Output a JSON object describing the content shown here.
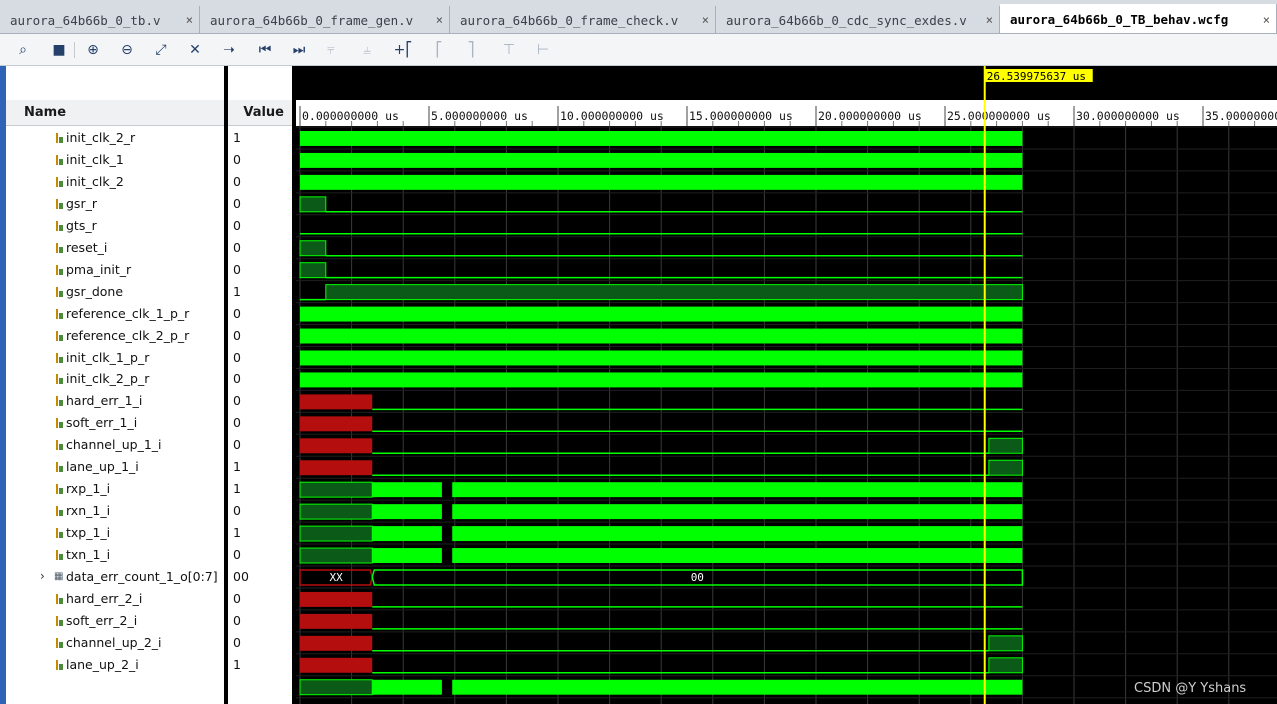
{
  "tabs": [
    {
      "label": "aurora_64b66b_0_tb.v",
      "close": "×",
      "active": false
    },
    {
      "label": "aurora_64b66b_0_frame_gen.v",
      "close": "×",
      "active": false
    },
    {
      "label": "aurora_64b66b_0_frame_check.v",
      "close": "×",
      "active": false
    },
    {
      "label": "aurora_64b66b_0_cdc_sync_exdes.v",
      "close": "×",
      "active": false
    },
    {
      "label": "aurora_64b66b_0_TB_behav.wcfg",
      "close": "×",
      "active": true
    }
  ],
  "toolbar": {
    "buttons": [
      "search-icon",
      "save-icon",
      "zoom-in-icon",
      "zoom-out-icon",
      "zoom-fit-icon",
      "cursor-remove-icon",
      "go-to-time-icon",
      "go-to-start-icon",
      "go-to-end-icon",
      "add-marker-icon",
      "remove-marker-icon",
      "add-marker-plus-icon",
      "previous-edge-icon",
      "next-edge-icon",
      "previous-transition-icon",
      "swap-cursor-icon"
    ]
  },
  "columns": {
    "name": "Name",
    "value": "Value"
  },
  "cursor": {
    "label": "26.539975637 us",
    "time_us": 26.539975637
  },
  "time_axis": {
    "ticks": [
      "0.000000000 us",
      "5.000000000 us",
      "10.000000000 us",
      "15.000000000 us",
      "20.000000000 us",
      "25.000000000 us",
      "30.000000000 us",
      "35.00000000"
    ],
    "sim_end_us": 28.0
  },
  "signals": [
    {
      "name": "init_clk_2_r",
      "value": "1",
      "wave": "clock"
    },
    {
      "name": "init_clk_1",
      "value": "0",
      "wave": "clock"
    },
    {
      "name": "init_clk_2",
      "value": "0",
      "wave": "clock"
    },
    {
      "name": "gsr_r",
      "value": "0",
      "wave": "pulse_start"
    },
    {
      "name": "gts_r",
      "value": "0",
      "wave": "low"
    },
    {
      "name": "reset_i",
      "value": "0",
      "wave": "pulse_start"
    },
    {
      "name": "pma_init_r",
      "value": "0",
      "wave": "pulse_start"
    },
    {
      "name": "gsr_done",
      "value": "1",
      "wave": "rise_early"
    },
    {
      "name": "reference_clk_1_p_r",
      "value": "0",
      "wave": "clock"
    },
    {
      "name": "reference_clk_2_p_r",
      "value": "0",
      "wave": "clock"
    },
    {
      "name": "init_clk_1_p_r",
      "value": "0",
      "wave": "clock"
    },
    {
      "name": "init_clk_2_p_r",
      "value": "0",
      "wave": "clock"
    },
    {
      "name": "hard_err_1_i",
      "value": "0",
      "wave": "x_then_low"
    },
    {
      "name": "soft_err_1_i",
      "value": "0",
      "wave": "x_then_low"
    },
    {
      "name": "channel_up_1_i",
      "value": "0",
      "wave": "x_low_high_end"
    },
    {
      "name": "lane_up_1_i",
      "value": "1",
      "wave": "x_low_high_end"
    },
    {
      "name": "rxp_1_i",
      "value": "1",
      "wave": "serial"
    },
    {
      "name": "rxn_1_i",
      "value": "0",
      "wave": "serial"
    },
    {
      "name": "txp_1_i",
      "value": "1",
      "wave": "serial"
    },
    {
      "name": "txn_1_i",
      "value": "0",
      "wave": "serial"
    },
    {
      "name": "data_err_count_1_o[0:7]",
      "value": "00",
      "wave": "bus",
      "bus_values": [
        "XX",
        "00"
      ],
      "expandable": true
    },
    {
      "name": "hard_err_2_i",
      "value": "0",
      "wave": "x_then_low"
    },
    {
      "name": "soft_err_2_i",
      "value": "0",
      "wave": "x_then_low"
    },
    {
      "name": "channel_up_2_i",
      "value": "0",
      "wave": "x_low_high_end"
    },
    {
      "name": "lane_up_2_i",
      "value": "1",
      "wave": "x_low_high_end"
    },
    {
      "name": "",
      "value": "",
      "wave": "serial"
    }
  ],
  "watermark": "CSDN @Y   Yshans",
  "colors": {
    "wave_green": "#00ff00",
    "dark_green": "#0b5a17",
    "x_red": "#b50e0e",
    "cursor_yellow": "#ffff00",
    "grid": "#3a3a3a"
  }
}
